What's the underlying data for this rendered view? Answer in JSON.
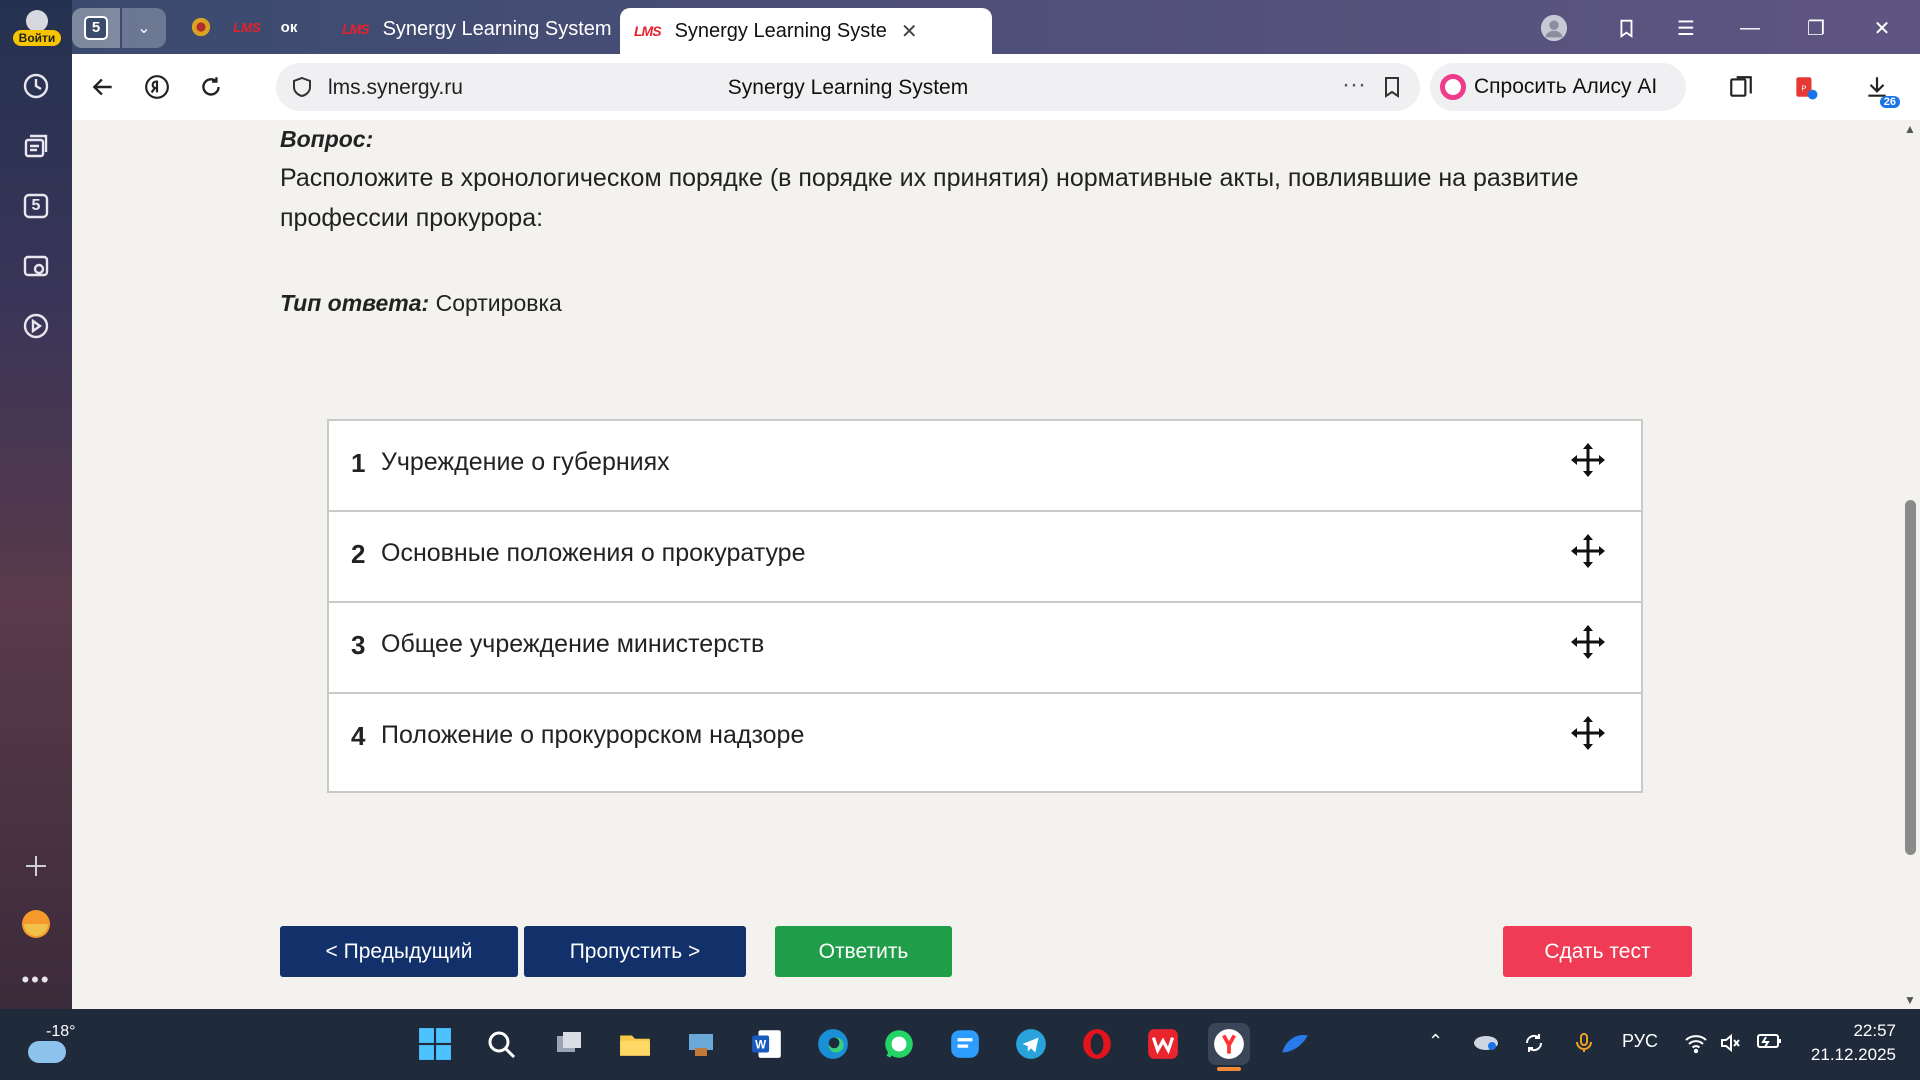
{
  "browser": {
    "login_label": "Войти",
    "tab_count": "5",
    "pinned_ok": "ок",
    "pinned_lms": "LMS",
    "tabs": [
      {
        "favicon": "LMS",
        "title": "Synergy Learning System"
      },
      {
        "favicon": "LMS",
        "title": "Synergy Learning Syste",
        "close": "✕"
      }
    ],
    "url": "lms.synergy.ru",
    "page_title": "Synergy Learning System",
    "omnibox_menu": "···",
    "alice_label": "Спросить Алису AI",
    "downloads_count": "26",
    "sidebar_counter": "5"
  },
  "question": {
    "label": "Вопрос:",
    "text": "Расположите в хронологическом порядке (в порядке их принятия) нормативные акты, повлиявшие на развитие профессии прокурора:",
    "answer_type_label": "Тип ответа:",
    "answer_type_value": "Сортировка"
  },
  "items": [
    {
      "num": "1",
      "text": "Учреждение о губерниях"
    },
    {
      "num": "2",
      "text": "Основные положения о прокуратуре"
    },
    {
      "num": "3",
      "text": "Общее учреждение министерств"
    },
    {
      "num": "4",
      "text": "Положение о прокурорском надзоре"
    }
  ],
  "buttons": {
    "prev": "< Предыдущий",
    "skip": "Пропустить >",
    "answer": "Ответить",
    "submit": "Сдать тест"
  },
  "colors": {
    "nav_button": "#12306a",
    "answer_button": "#1f9d48",
    "submit_button": "#ef3b54"
  },
  "taskbar": {
    "temperature": "-18°",
    "language": "РУС",
    "time": "22:57",
    "date": "21.12.2025"
  }
}
